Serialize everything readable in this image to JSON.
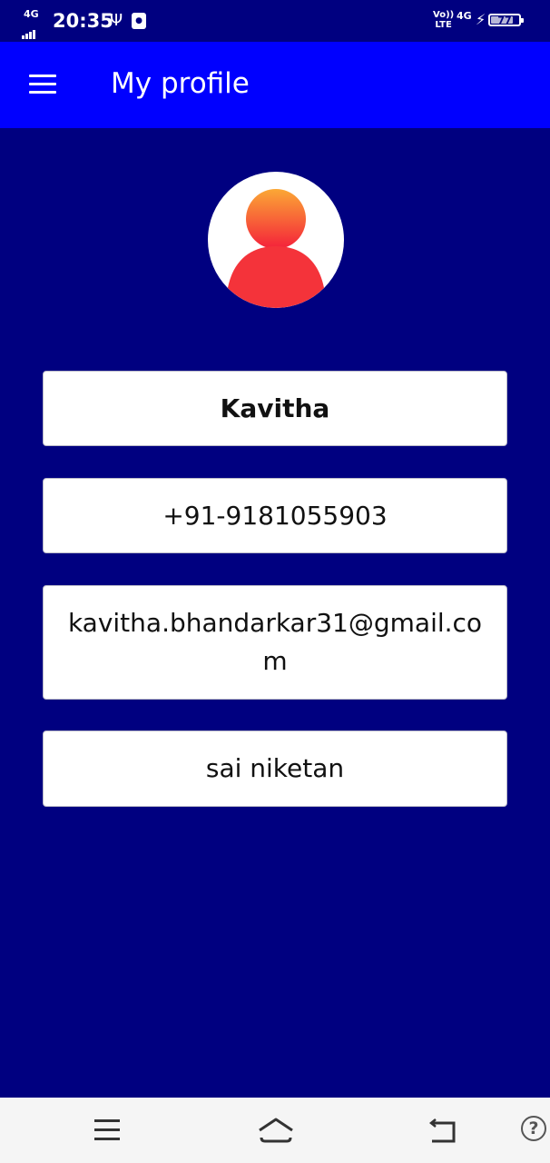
{
  "status_bar": {
    "network_type": "4G",
    "time": "20:35",
    "volte_label": "Vo))\nLTE",
    "network_type_right": "4G",
    "battery_level": "77",
    "icons": [
      "signal-icon",
      "usb-icon",
      "app-notification-icon",
      "volte-icon",
      "charging-icon",
      "battery-icon"
    ]
  },
  "app_bar": {
    "title": "My profile",
    "menu_icon": "hamburger-menu-icon",
    "background_color": "#0000ff"
  },
  "profile": {
    "avatar_icon": "user-avatar-icon",
    "name": "Kavitha",
    "phone": "+91-9181055903",
    "email": "kavitha.bhandarkar31@gmail.com",
    "address": "sai niketan"
  },
  "nav_bar": {
    "icons": [
      "recent-apps-icon",
      "home-icon",
      "back-icon",
      "help-icon"
    ],
    "help_label": "?"
  },
  "colors": {
    "page_background": "#000080",
    "app_bar": "#0000ff",
    "field_background": "#ffffff",
    "avatar_gradient_top": "#fba835",
    "avatar_gradient_bottom": "#f4213a"
  }
}
